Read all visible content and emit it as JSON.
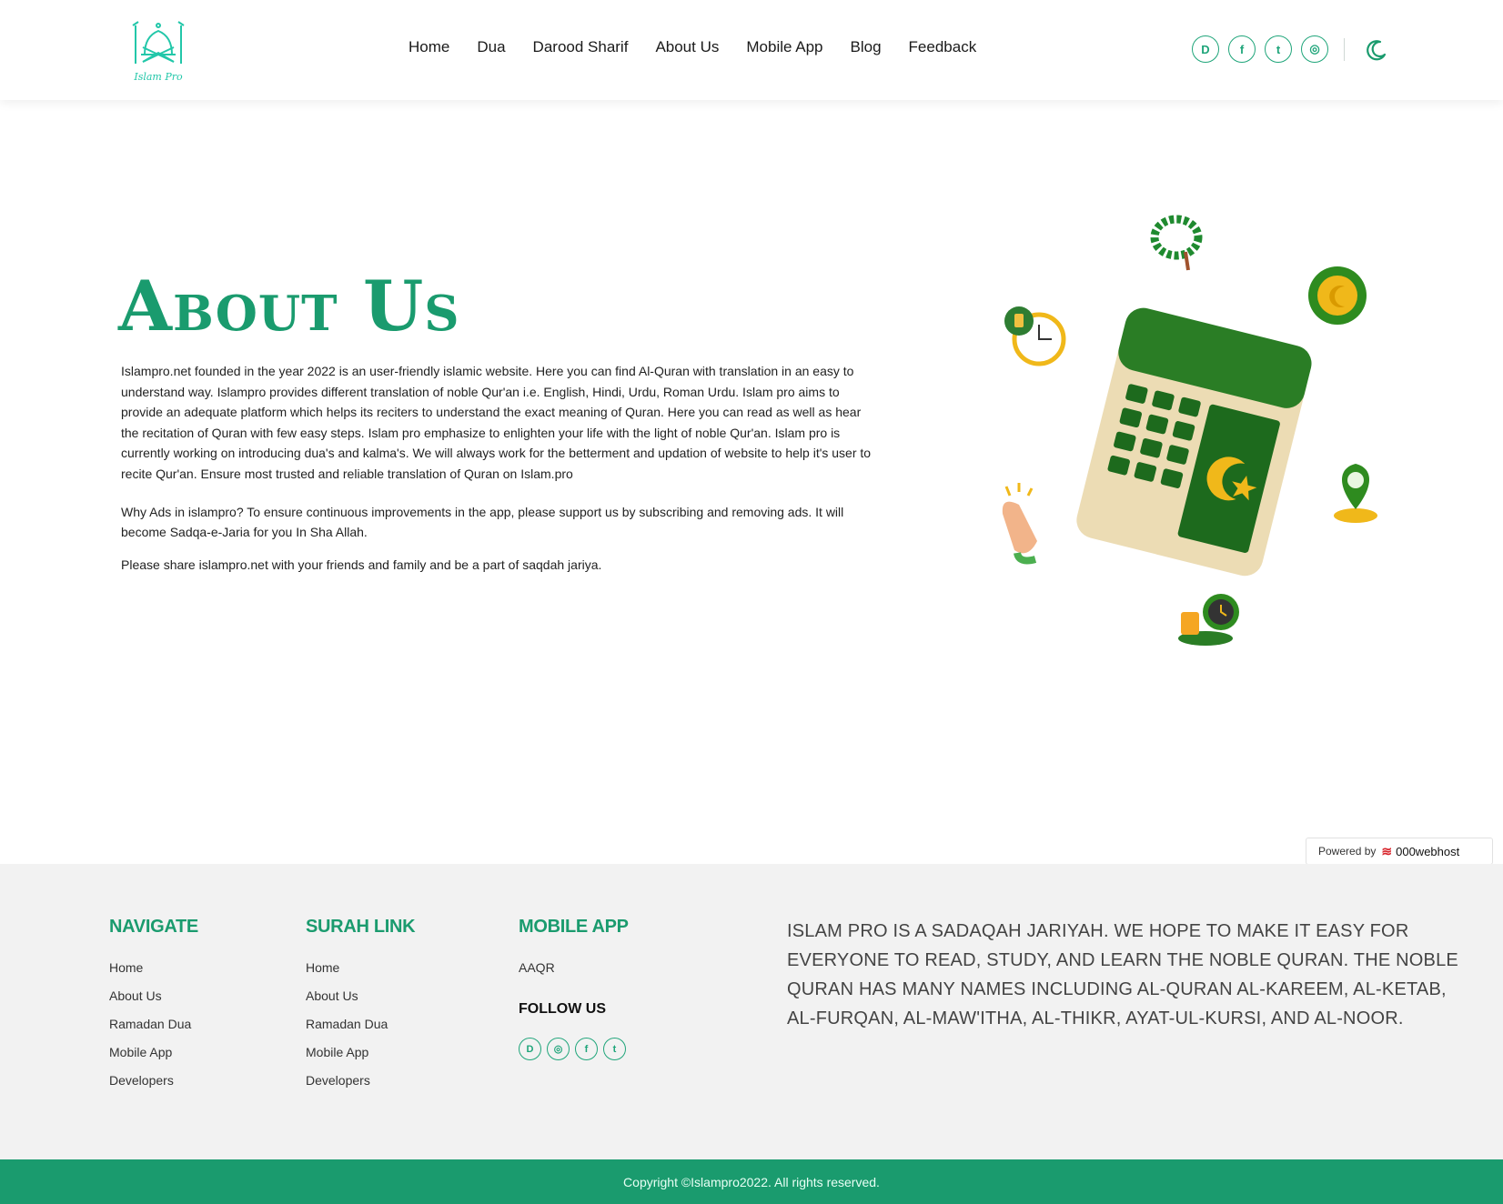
{
  "brand": {
    "logo_text": "Islam Pro"
  },
  "nav": {
    "items": [
      "Home",
      "Dua",
      "Darood Sharif",
      "About Us",
      "Mobile App",
      "Blog",
      "Feedback"
    ]
  },
  "header_social": [
    {
      "icon": "dailymotion-icon",
      "glyph": "D"
    },
    {
      "icon": "facebook-icon",
      "glyph": "f"
    },
    {
      "icon": "twitter-icon",
      "glyph": "t"
    },
    {
      "icon": "instagram-icon",
      "glyph": "◎"
    }
  ],
  "theme_toggle": {
    "icon": "moon-icon"
  },
  "about": {
    "title": "About Us",
    "paragraph1": "Islampro.net founded in the year 2022 is an user-friendly islamic website. Here you can find Al-Quran with translation in an easy to understand way. Islampro provides different translation of noble Qur'an i.e. English, Hindi, Urdu, Roman Urdu. Islam pro aims to provide an adequate platform which helps its reciters to understand the exact meaning of Quran. Here you can read as well as hear the recitation of Quran with few easy steps. Islam pro emphasize to enlighten your life with the light of noble Qur'an. Islam pro is currently working on introducing dua's and kalma's. We will always work for the betterment and updation of website to help it's user to recite Qur'an. Ensure most trusted and reliable translation of Quran on Islam.pro",
    "paragraph2": "Why Ads in islampro? To ensure continuous improvements in the app, please support us by subscribing and removing ads. It will become Sadqa-e-Jaria for you In Sha Allah.",
    "paragraph3": "Please share islampro.net with your friends and family and be a part of saqdah jariya."
  },
  "powered_by": {
    "label": "Powered by",
    "brand": "000webhost"
  },
  "footer": {
    "navigate": {
      "title": "NAVIGATE",
      "links": [
        "Home",
        "About Us",
        "Ramadan Dua",
        "Mobile App",
        "Developers"
      ]
    },
    "surah_link": {
      "title": "SURAH LINK",
      "links": [
        "Home",
        "About Us",
        "Ramadan Dua",
        "Mobile App",
        "Developers"
      ]
    },
    "mobile_app": {
      "title": "MOBILE APP",
      "links": [
        "AAQR"
      ]
    },
    "follow_us": {
      "title": "FOLLOW US"
    },
    "mission": "Islam Pro is a Sadaqah Jariyah. We hope to make it easy for everyone to read, study, and learn The Noble Quran. The Noble Quran has many names including Al-Quran Al-Kareem, Al-Ketab, Al-Furqan, Al-Maw'itha, Al-Thikr, Ayat-ul-Kursi, and Al-Noor.",
    "copyright": "Copyright ©Islampro2022. All rights reserved."
  },
  "colors": {
    "accent": "#1a9b6e",
    "footer_bg": "#f2f2f2",
    "copyright_bg": "#1a9b6e"
  }
}
